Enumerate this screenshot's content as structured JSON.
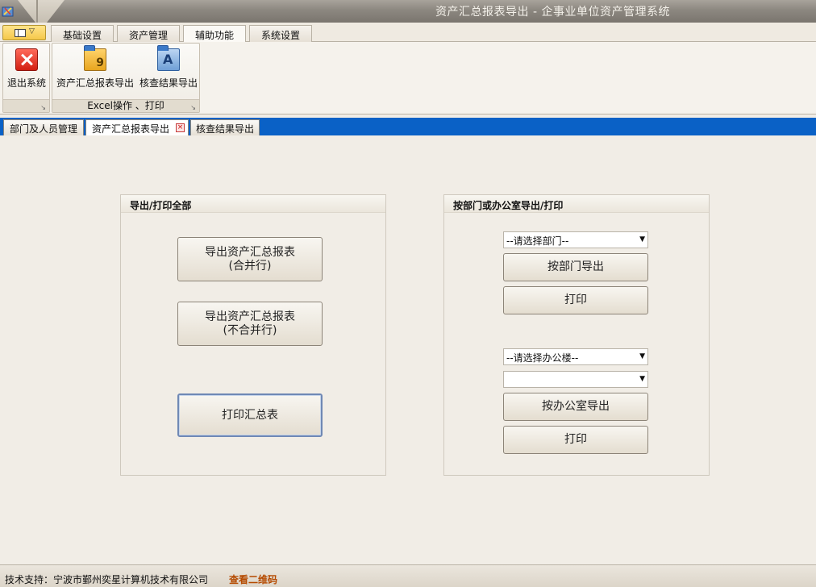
{
  "window": {
    "title": "资产汇总报表导出 - 企事业单位资产管理系统"
  },
  "menu": {
    "tabs": [
      {
        "label": "基础设置"
      },
      {
        "label": "资产管理"
      },
      {
        "label": "辅助功能"
      },
      {
        "label": "系统设置"
      }
    ],
    "active_tab": "辅助功能"
  },
  "ribbon": {
    "group1": {
      "label": "",
      "exit_label": "退出系统"
    },
    "group2": {
      "label": "Excel操作 、打印",
      "summary_export_label": "资产汇总报表导出",
      "check_export_label": "核查结果导出"
    },
    "icon_glyphs": {
      "summary": "9",
      "check": "A"
    }
  },
  "doc_tabs": [
    {
      "label": "部门及人员管理"
    },
    {
      "label": "资产汇总报表导出"
    },
    {
      "label": "核查结果导出"
    }
  ],
  "export_all": {
    "title": "导出/打印全部",
    "btn_merged": "导出资产汇总报表\n(合并行)",
    "btn_unmerged": "导出资产汇总报表\n(不合并行)",
    "btn_print": "打印汇总表"
  },
  "export_by": {
    "title": "按部门或办公室导出/打印",
    "dept_select": "--请选择部门--",
    "btn_dept_export": "按部门导出",
    "btn_dept_print": "打印",
    "building_select": "--请选择办公楼--",
    "room_select": "",
    "btn_office_export": "按办公室导出",
    "btn_office_print": "打印"
  },
  "status": {
    "support": "技术支持：宁波市鄞州奕星计算机技术有限公司",
    "qr_link": "查看二维码"
  },
  "colors": {
    "doc_tab_bar": "#0a61c6",
    "qr_link": "#b54a00",
    "title_bar": "#8c8780"
  }
}
